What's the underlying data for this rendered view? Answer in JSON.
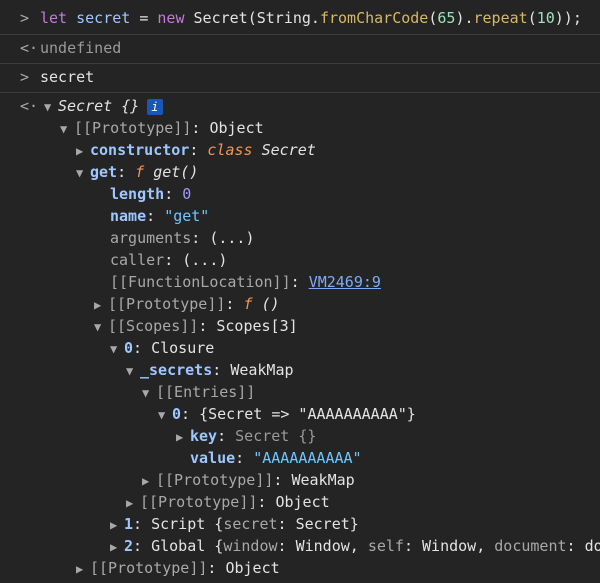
{
  "input1": {
    "kw_let": "let",
    "var_secret": "secret",
    "eq": "=",
    "kw_new": "new",
    "ctor": "Secret(String.",
    "method1": "fromCharCode",
    "open1": "(",
    "num65": "65",
    "close1": ").",
    "method2": "repeat",
    "open2": "(",
    "num10": "10",
    "close2": "));"
  },
  "output1": {
    "text": "undefined"
  },
  "input2": {
    "text": "secret"
  },
  "tree": {
    "root_label": "Secret {}",
    "info_badge": "i",
    "proto1": {
      "key": "[[Prototype]]",
      "colon": ":",
      "value": "Object"
    },
    "constructor": {
      "key": "constructor",
      "colon": ":",
      "kw": "class",
      "value": "Secret"
    },
    "get": {
      "key": "get",
      "colon": ":",
      "f": "f",
      "value": "get()"
    },
    "length": {
      "key": "length",
      "colon": ":",
      "value": "0"
    },
    "name": {
      "key": "name",
      "colon": ":",
      "value": "\"get\""
    },
    "arguments": {
      "key": "arguments",
      "colon": ":",
      "value": "(...)"
    },
    "caller": {
      "key": "caller",
      "colon": ":",
      "value": "(...)"
    },
    "fnloc": {
      "key": "[[FunctionLocation]]",
      "colon": ":",
      "value": "VM2469:9"
    },
    "proto2": {
      "key": "[[Prototype]]",
      "colon": ":",
      "f": "f",
      "value": "()"
    },
    "scopes": {
      "key": "[[Scopes]]",
      "colon": ":",
      "value": "Scopes[3]"
    },
    "closure": {
      "key": "0",
      "colon": ":",
      "value": "Closure"
    },
    "secrets": {
      "key": "_secrets",
      "colon": ":",
      "value": "WeakMap"
    },
    "entries": {
      "key": "[[Entries]]"
    },
    "entry0": {
      "key": "0",
      "colon": ":",
      "value": "{Secret => \"AAAAAAAAAA\"}"
    },
    "ekey": {
      "key": "key",
      "colon": ":",
      "value": "Secret {}"
    },
    "evalue": {
      "key": "value",
      "colon": ":",
      "value": "\"AAAAAAAAAA\""
    },
    "proto3": {
      "key": "[[Prototype]]",
      "colon": ":",
      "value": "WeakMap"
    },
    "proto4": {
      "key": "[[Prototype]]",
      "colon": ":",
      "value": "Object"
    },
    "script": {
      "key": "1",
      "colon": ":",
      "value_a": "Script {",
      "k": "secret",
      "v": ": Secret}"
    },
    "global": {
      "key": "2",
      "colon": ":",
      "value_a": "Global {",
      "k1": "window",
      "v1": ": Window, ",
      "k2": "self",
      "v2": ": Window, ",
      "k3": "document",
      "v3": ": do"
    },
    "proto5": {
      "key": "[[Prototype]]",
      "colon": ":",
      "value": "Object"
    }
  }
}
